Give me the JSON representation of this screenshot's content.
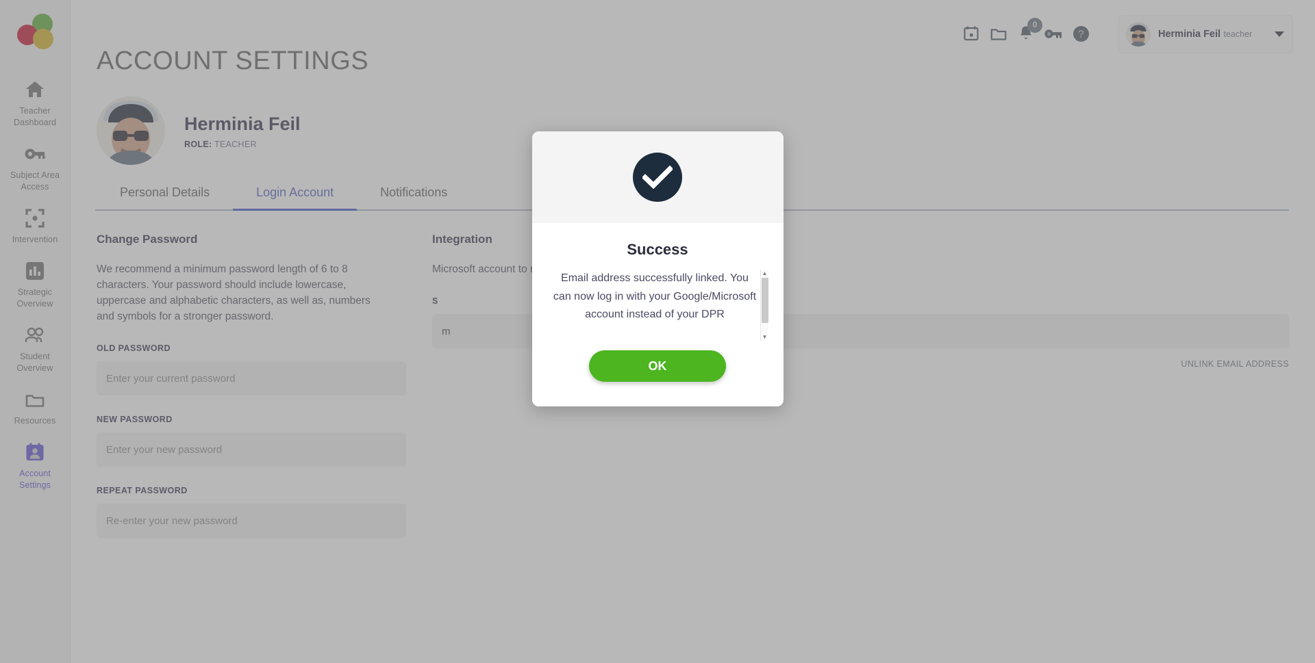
{
  "sidebar": {
    "logo_name": "traffic-light-logo",
    "items": [
      {
        "id": "teacher-dashboard",
        "label": "Teacher Dashboard",
        "icon": "home-icon",
        "active": false
      },
      {
        "id": "subject-area-access",
        "label": "Subject Area Access",
        "icon": "key-icon",
        "active": false
      },
      {
        "id": "intervention",
        "label": "Intervention",
        "icon": "target-icon",
        "active": false
      },
      {
        "id": "strategic-overview",
        "label": "Strategic Overview",
        "icon": "bar-chart-icon",
        "active": false
      },
      {
        "id": "student-overview",
        "label": "Student Overview",
        "icon": "users-icon",
        "active": false
      },
      {
        "id": "resources",
        "label": "Resources",
        "icon": "folder-icon",
        "active": false
      },
      {
        "id": "account-settings",
        "label": "Account Settings",
        "icon": "id-card-icon",
        "active": true
      }
    ],
    "active_color": "#5b4fd6",
    "inactive_color": "#6e6e6e"
  },
  "topbar": {
    "icons": [
      {
        "name": "calendar-icon",
        "label": "Calendar"
      },
      {
        "name": "folder-icon",
        "label": "Files"
      },
      {
        "name": "bell-icon",
        "label": "Notifications",
        "badge": "0"
      },
      {
        "name": "key-icon",
        "label": "Permissions"
      },
      {
        "name": "help-icon",
        "label": "Help"
      }
    ],
    "user": {
      "name": "Herminia Feil",
      "role": "teacher"
    }
  },
  "page": {
    "title": "ACCOUNT SETTINGS",
    "profile": {
      "name": "Herminia Feil",
      "role_label": "ROLE:",
      "role_value": "TEACHER"
    },
    "tabs": [
      {
        "id": "personal-details",
        "label": "Personal Details",
        "active": false
      },
      {
        "id": "login-account",
        "label": "Login Account",
        "active": true
      },
      {
        "id": "notifications",
        "label": "Notifications",
        "active": false
      }
    ],
    "tab_active_color": "#3b53c4"
  },
  "change_password": {
    "title": "Change Password",
    "description": "We recommend a minimum password length of 6 to 8 characters. Your password should include lowercase, uppercase and alphabetic characters, as well as, numbers and symbols for a stronger password.",
    "fields": [
      {
        "id": "old-password",
        "label": "OLD PASSWORD",
        "placeholder": "Enter your current password",
        "value": ""
      },
      {
        "id": "new-password",
        "label": "NEW PASSWORD",
        "placeholder": "Enter your new password",
        "value": ""
      },
      {
        "id": "repeat-password",
        "label": "REPEAT PASSWORD",
        "placeholder": "Re-enter your new password",
        "value": ""
      }
    ]
  },
  "integration": {
    "title": "Integration",
    "description": "Microsoft account to make logging in",
    "field_label": "S",
    "field_value": "m",
    "unlink_label": "UNLINK EMAIL ADDRESS"
  },
  "modal": {
    "icon": "check-circle-icon",
    "title": "Success",
    "text": "Email address successfully linked. You can now log in with your Google/Microsoft account instead of your DPR",
    "ok_label": "OK",
    "ok_color": "#4cb520",
    "icon_color": "#1e2d3d"
  }
}
